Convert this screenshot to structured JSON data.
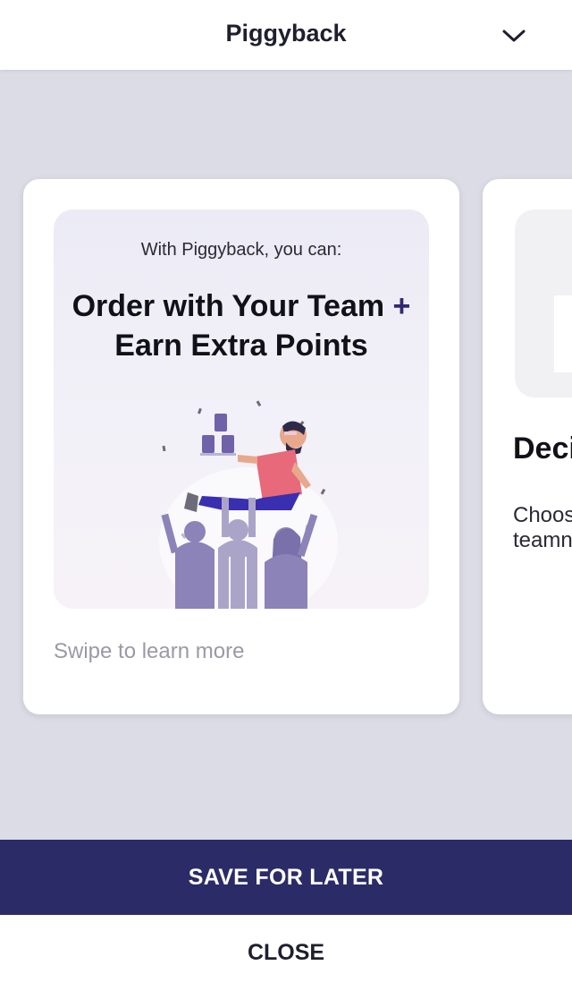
{
  "header": {
    "title": "Piggyback",
    "menu_icon": "chevron-down-icon"
  },
  "card_1": {
    "subtitle": "With Piggyback, you can:",
    "headline_line1": "Order with Your Team",
    "headline_plus": "+",
    "headline_line2": "Earn Extra Points",
    "footer": "Swipe to learn more"
  },
  "card_2": {
    "title": "Deci",
    "body_line1": "Choos",
    "body_line2": "teamn"
  },
  "actions": {
    "save_label": "SAVE FOR LATER",
    "close_label": "CLOSE"
  },
  "colors": {
    "accent": "#2b2b68",
    "background": "#dcdce7",
    "illustration_purple": "#6f62a8",
    "shirt": "#e8697a"
  }
}
